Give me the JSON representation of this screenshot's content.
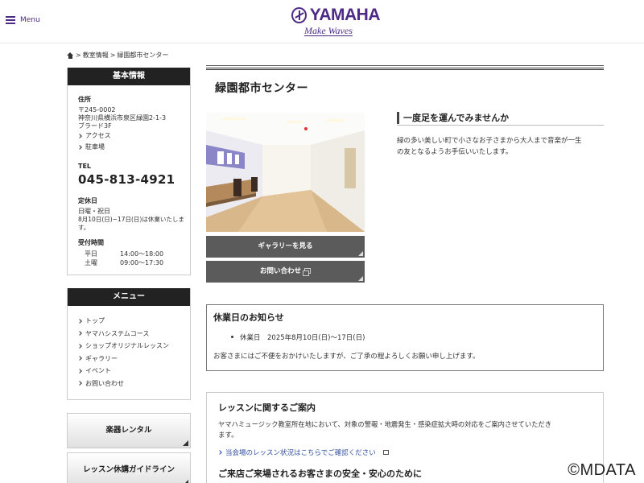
{
  "header": {
    "menu_label": "Menu",
    "logo_word": "YAMAHA",
    "logo_tagline": "Make Waves"
  },
  "breadcrumb": {
    "items": [
      "教室情報",
      "緑園都市センター"
    ],
    "separator": ">"
  },
  "sidebar": {
    "basic_info": {
      "heading": "基本情報",
      "address_label": "住所",
      "postal": "〒245-0002",
      "address": "神奈川県横浜市泉区緑園2-1-3",
      "building": "ブラード3F",
      "links": [
        "アクセス",
        "駐車場"
      ],
      "tel_label": "TEL",
      "tel": "045-813-4921",
      "holiday_label": "定休日",
      "holiday_line1": "日曜・祝日",
      "holiday_line2": "8月10日(日)~17日(日)は休業いたしま",
      "holiday_line3": "す。",
      "hours_label": "受付時間",
      "hours": [
        {
          "day": "平日",
          "time": "14:00～18:00"
        },
        {
          "day": "土曜",
          "time": "09:00～17:30"
        }
      ]
    },
    "menu": {
      "heading": "メニュー",
      "items": [
        "トップ",
        "ヤマハシステムコース",
        "ショップオリジナルレッスン",
        "ギャラリー",
        "イベント",
        "お問い合わせ"
      ]
    },
    "buttons": [
      "楽器レンタル",
      "レッスン休講ガイドライン"
    ]
  },
  "main": {
    "title": "緑園都市センター",
    "gallery_button": "ギャラリーを見る",
    "contact_button": "お問い合わせ",
    "catch_heading": "一度足を運んでみませんか",
    "catch_text_1": "緑の多い美しい町で小さなお子さまから大人まで音楽が一生",
    "catch_text_2": "の友となるようお手伝いいたします。",
    "notice": {
      "heading": "休業日のお知らせ",
      "item": "休業日　2025年8月10日(日)～17日(日)",
      "text": "お客さまにはご不便をおかけいたしますが、ご了承の程よろしくお願い申し上げます。"
    },
    "lesson": {
      "heading": "レッスンに関するご案内",
      "text_1": "ヤマハミュージック教室所在地において、対象の警報・地震発生・感染症拡大時の対応をご案内させていただき",
      "text_2": "ます。",
      "link": "当会場のレッスン状況はこちらでご確認ください",
      "heading2": "ご来店ご来場されるお客さまの安全・安心のために"
    }
  },
  "watermark": "©MDATA",
  "colors": {
    "brand": "#4c2a85",
    "dark_header": "#222222",
    "button_gray": "#5b5b5b",
    "link": "#3050a0"
  }
}
